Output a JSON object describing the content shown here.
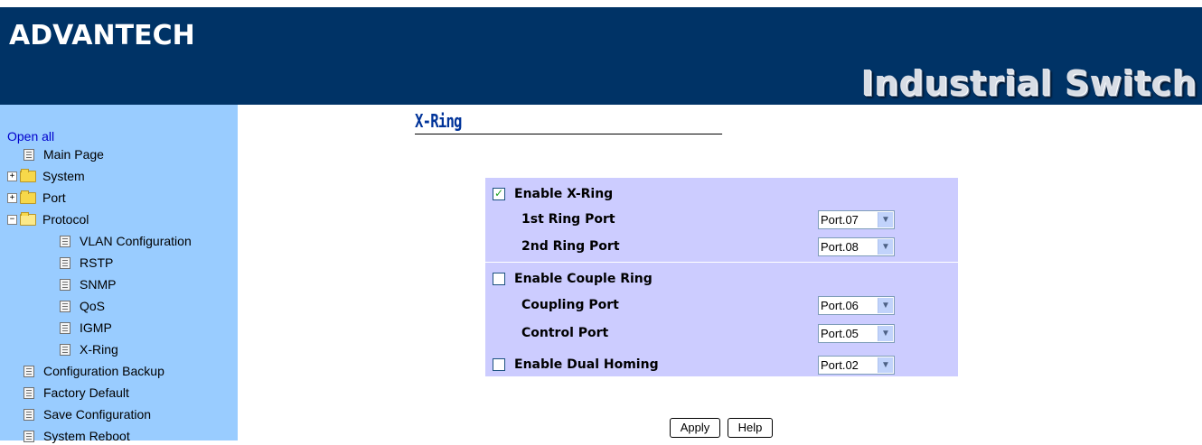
{
  "header": {
    "logo": "ADVANTECH",
    "product": "Industrial Switch",
    "colors": {
      "banner": "#003366",
      "sidebar": "#99ccff",
      "panel": "#ccccff"
    }
  },
  "sidebar": {
    "open_all": "Open all",
    "items": [
      {
        "label": "Main Page",
        "icon": "document-icon"
      },
      {
        "label": "System",
        "icon": "folder-icon",
        "expander": "+"
      },
      {
        "label": "Port",
        "icon": "folder-icon",
        "expander": "+"
      },
      {
        "label": "Protocol",
        "icon": "open-folder-icon",
        "expander": "−"
      },
      {
        "label": "VLAN Configuration",
        "icon": "document-icon"
      },
      {
        "label": "RSTP",
        "icon": "document-icon"
      },
      {
        "label": "SNMP",
        "icon": "document-icon"
      },
      {
        "label": "QoS",
        "icon": "document-icon"
      },
      {
        "label": "IGMP",
        "icon": "document-icon"
      },
      {
        "label": "X-Ring",
        "icon": "document-icon"
      },
      {
        "label": "Configuration Backup",
        "icon": "document-icon"
      },
      {
        "label": "Factory Default",
        "icon": "document-icon"
      },
      {
        "label": "Save Configuration",
        "icon": "document-icon"
      },
      {
        "label": "System Reboot",
        "icon": "document-icon"
      }
    ]
  },
  "main": {
    "title": "X-Ring",
    "enable_xring": {
      "label": "Enable X-Ring",
      "checked": true
    },
    "first_ring_port": {
      "label": "1st Ring Port",
      "value": "Port.07"
    },
    "second_ring_port": {
      "label": "2nd Ring Port",
      "value": "Port.08"
    },
    "enable_couple_ring": {
      "label": "Enable Couple Ring",
      "checked": false
    },
    "coupling_port": {
      "label": "Coupling Port",
      "value": "Port.06"
    },
    "control_port": {
      "label": "Control Port",
      "value": "Port.05"
    },
    "enable_dual_homing": {
      "label": "Enable Dual Homing",
      "checked": false,
      "value": "Port.02"
    },
    "buttons": {
      "apply": "Apply",
      "help": "Help"
    }
  }
}
